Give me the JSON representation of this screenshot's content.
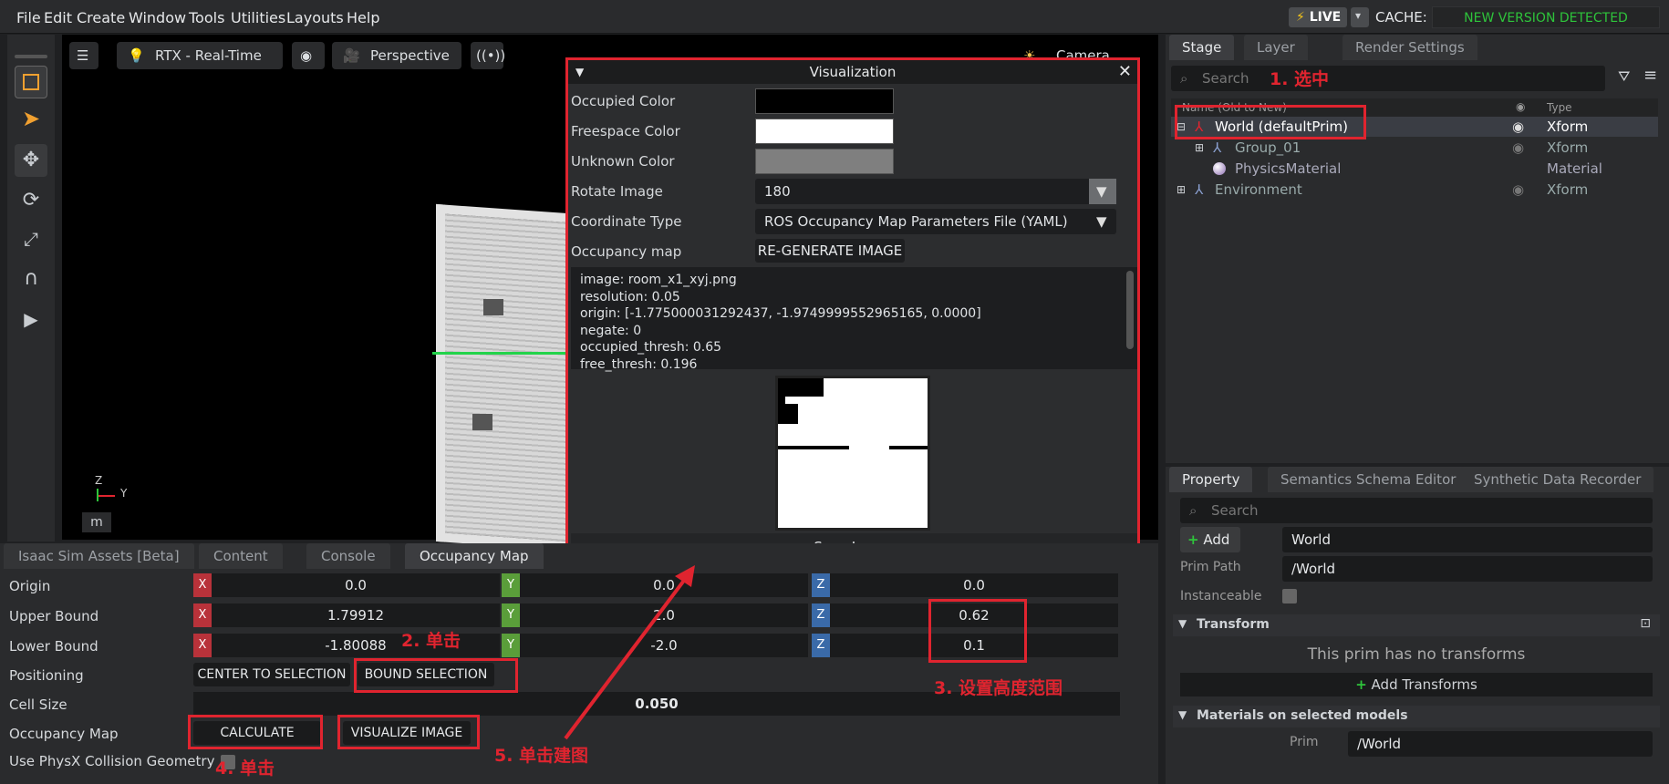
{
  "menu": [
    "File",
    "Edit",
    "Create",
    "Window",
    "Tools",
    "Utilities",
    "Layouts",
    "Help"
  ],
  "topbar": {
    "live": "LIVE",
    "cache": "CACHE:",
    "new_version": "NEW VERSION DETECTED"
  },
  "viewport": {
    "render_mode": "RTX - Real-Time",
    "camera": "Perspective",
    "camera_light": "Camera Light",
    "axis_z": "Z",
    "axis_y": "Y",
    "unit": "m"
  },
  "visualization": {
    "title": "Visualization",
    "occupied_color_label": "Occupied Color",
    "freespace_color_label": "Freespace Color",
    "unknown_color_label": "Unknown Color",
    "rotate_image_label": "Rotate Image",
    "rotate_image_value": "180",
    "coordinate_type_label": "Coordinate Type",
    "coordinate_type_value": "ROS Occupancy Map Parameters File (YAML)",
    "occupancy_map_label": "Occupancy map",
    "regenerate_label": "RE-GENERATE IMAGE",
    "yaml": [
      "image: room_x1_xyj.png",
      "resolution: 0.05",
      "origin: [-1.775000031292437, -1.9749999552965165, 0.0000]",
      "negate: 0",
      "occupied_thresh: 0.65",
      "free_thresh: 0.196"
    ],
    "save_label": "Save Image",
    "colors": {
      "occupied": "#000000",
      "freespace": "#ffffff",
      "unknown": "#7f7f7f"
    }
  },
  "bottom_tabs": [
    "Isaac Sim Assets [Beta]",
    "Content",
    "Console",
    "Occupancy Map"
  ],
  "occupancy": {
    "origin_label": "Origin",
    "origin": [
      "0.0",
      "0.0",
      "0.0"
    ],
    "upper_label": "Upper Bound",
    "upper": [
      "1.79912",
      "2.0",
      "0.62"
    ],
    "lower_label": "Lower Bound",
    "lower": [
      "-1.80088",
      "-2.0",
      "0.1"
    ],
    "positioning_label": "Positioning",
    "center_label": "CENTER TO SELECTION",
    "bound_label": "BOUND SELECTION",
    "cell_size_label": "Cell Size",
    "cell_size": "0.050",
    "map_label": "Occupancy Map",
    "calculate_label": "CALCULATE",
    "visualize_label": "VISUALIZE IMAGE",
    "physx_label": "Use PhysX Collision Geometry",
    "axes": [
      "X",
      "Y",
      "Z"
    ]
  },
  "stage": {
    "tabs": [
      "Stage",
      "Layer",
      "Render Settings"
    ],
    "search_placeholder": "Search",
    "col_name": "Name (Old to New)",
    "col_type": "Type",
    "rows": [
      {
        "name": "World (defaultPrim)",
        "type": "Xform"
      },
      {
        "name": "Group_01",
        "type": "Xform"
      },
      {
        "name": "PhysicsMaterial",
        "type": "Material"
      },
      {
        "name": "Environment",
        "type": "Xform"
      }
    ]
  },
  "property": {
    "tabs": [
      "Property",
      "Semantics Schema Editor",
      "Synthetic Data Recorder"
    ],
    "search_placeholder": "Search",
    "add_label": "Add",
    "name_value": "World",
    "prim_path_label": "Prim Path",
    "prim_path_value": "/World",
    "instanceable_label": "Instanceable",
    "transform_label": "Transform",
    "no_transform": "This prim has no transforms",
    "add_transforms": "Add Transforms",
    "materials_label": "Materials on selected models",
    "prim_label": "Prim",
    "prim_value": "/World"
  },
  "annotations": {
    "a1": "1. 选中",
    "a2": "2. 单击",
    "a3": "3. 设置高度范围",
    "a4": "4. 单击",
    "a5": "5. 单击建图"
  }
}
